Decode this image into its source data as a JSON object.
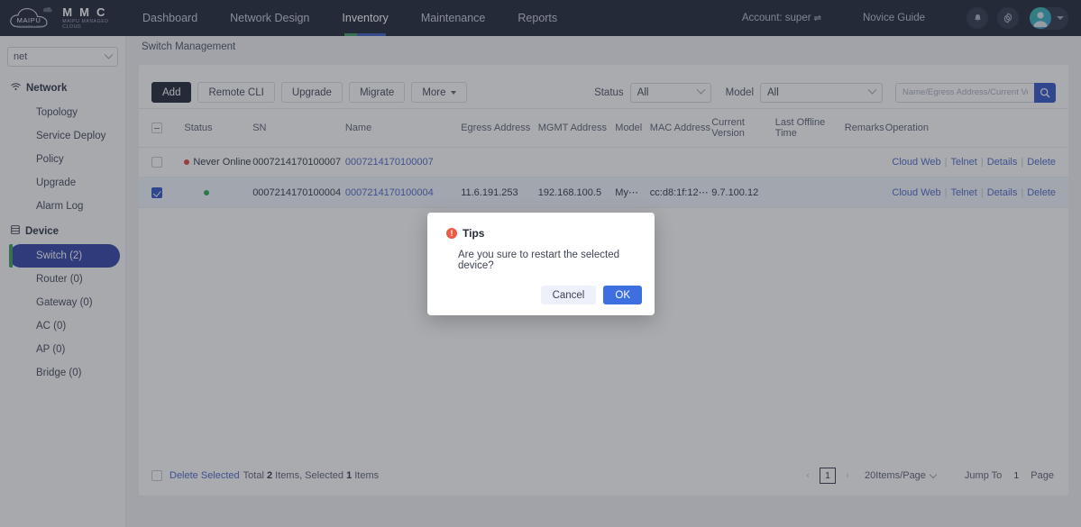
{
  "topnav": {
    "brand": {
      "name": "M M C",
      "subtitle": "MAIPU MANAGED CLOUD",
      "logo_text": "MAIPU",
      "logo_tagline": "MAKE IT INTELLIGENT"
    },
    "links": [
      {
        "label": "Dashboard",
        "active": false
      },
      {
        "label": "Network Design",
        "active": false
      },
      {
        "label": "Inventory",
        "active": true
      },
      {
        "label": "Maintenance",
        "active": false
      },
      {
        "label": "Reports",
        "active": false
      }
    ],
    "account": "Account: super",
    "account_swap_icon": "swap-icon",
    "novice_guide": "Novice Guide",
    "bell_icon": "bell-icon",
    "gear_icon": "gear-icon",
    "avatar_icon": "avatar-icon"
  },
  "sidebar": {
    "net_select": {
      "value": "net"
    },
    "groups": [
      {
        "label": "Network",
        "icon": "wifi-icon",
        "items": [
          {
            "label": "Topology",
            "active": false
          },
          {
            "label": "Service Deploy",
            "active": false
          },
          {
            "label": "Policy",
            "active": false
          },
          {
            "label": "Upgrade",
            "active": false
          },
          {
            "label": "Alarm Log",
            "active": false
          }
        ]
      },
      {
        "label": "Device",
        "icon": "device-list-icon",
        "items": [
          {
            "label": "Switch (2)",
            "active": true
          },
          {
            "label": "Router (0)",
            "active": false
          },
          {
            "label": "Gateway (0)",
            "active": false
          },
          {
            "label": "AC (0)",
            "active": false
          },
          {
            "label": "AP (0)",
            "active": false
          },
          {
            "label": "Bridge (0)",
            "active": false
          }
        ]
      }
    ]
  },
  "breadcrumb": "Switch Management",
  "toolbar": {
    "add": "Add",
    "remote_cli": "Remote CLI",
    "upgrade": "Upgrade",
    "migrate": "Migrate",
    "more": "More"
  },
  "filters": {
    "status_label": "Status",
    "status_value": "All",
    "model_label": "Model",
    "model_value": "All",
    "search_placeholder": "Name/Egress Address/Current Version",
    "search_value": "",
    "search_icon": "search-icon"
  },
  "table": {
    "columns": [
      "Status",
      "SN",
      "Name",
      "Egress Address",
      "MGMT Address",
      "Model",
      "MAC Address",
      "Current Version",
      "Last Offline Time",
      "Remarks",
      "Operation"
    ],
    "header_checkbox_state": "indeterminate",
    "rows": [
      {
        "selected": false,
        "status_dot": "red",
        "status": "Never Online",
        "sn": "0007214170100007",
        "name": "0007214170100007",
        "egress_address": "",
        "mgmt_address": "",
        "model": "",
        "mac_address": "",
        "current_version": "",
        "last_offline_time": "",
        "remarks": "",
        "operations": [
          "Cloud Web",
          "Telnet",
          "Details",
          "Delete"
        ]
      },
      {
        "selected": true,
        "status_dot": "green",
        "status": "",
        "sn": "0007214170100004",
        "name": "0007214170100004",
        "egress_address": "11.6.191.253",
        "mgmt_address": "192.168.100.5",
        "model": "My⋯",
        "mac_address": "cc:d8:1f:12⋯",
        "current_version": "9.7.100.12",
        "last_offline_time": "",
        "remarks": "",
        "operations": [
          "Cloud Web",
          "Telnet",
          "Details",
          "Delete"
        ]
      }
    ]
  },
  "footer": {
    "delete_selected": "Delete Selected",
    "total_prefix": "Total",
    "total_count": "2",
    "items_mid": "Items, Selected",
    "selected_count": "1",
    "items_suffix": "Items",
    "prev_arrow": "‹",
    "page_number": "1",
    "next_arrow": "›",
    "page_size": "20Items/Page",
    "jump_to": "Jump To",
    "jump_value": "1",
    "page_word": "Page"
  },
  "modal": {
    "icon": "exclamation-icon",
    "title": "Tips",
    "message": "Are you sure to restart the selected device?",
    "cancel": "Cancel",
    "ok": "OK"
  },
  "colors": {
    "nav_bg": "#1b2133",
    "accent_blue": "#2f52c8",
    "accent_green": "#3d9b5a",
    "link_blue": "#4a66c9",
    "ok_blue": "#3d6fe0",
    "danger_red": "#e8433c",
    "online_green": "#2fa84f",
    "warn_orange": "#ed5a45"
  }
}
